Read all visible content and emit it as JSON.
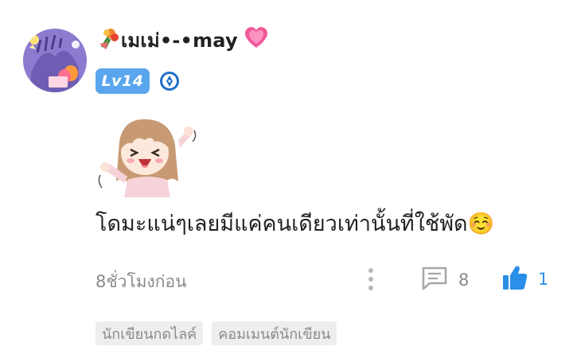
{
  "comment": {
    "username": "เมเม่•-•may",
    "prefix_emoji_icon": "bouquet-emoji-icon",
    "suffix_emoji_icon": "growing-heart-emoji-icon",
    "level_badge": "Lv14",
    "writer_badge_icon": "pen-nib-badge-icon",
    "sticker_icon": "excited-girl-sticker",
    "text": "โดมะแน่ๆเลยมีแค่คนเดียวเท่านั้นที่ใช้พัด☺️",
    "timestamp": "8ชั่วโมงก่อน",
    "reply_count": "8",
    "like_count": "1",
    "tags": [
      "นักเขียนกดไลค์",
      "คอมเมนต์นักเขียน"
    ]
  },
  "colors": {
    "accent_blue": "#5aa6ee",
    "like_blue": "#2a8fe8",
    "muted_text": "#8a8a8a",
    "tag_bg": "#eeeeee"
  }
}
